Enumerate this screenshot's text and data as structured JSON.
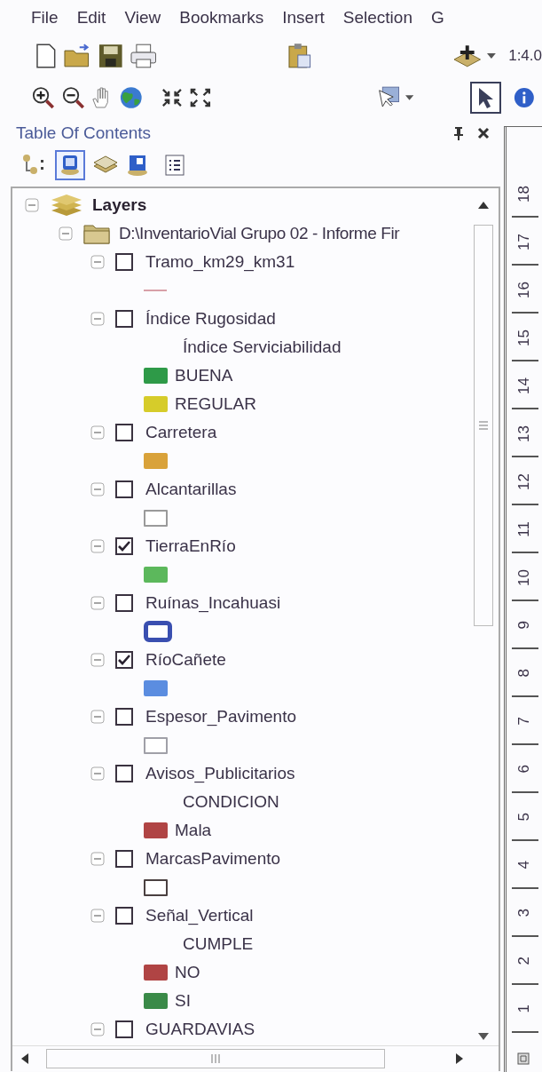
{
  "menu": [
    "File",
    "Edit",
    "View",
    "Bookmarks",
    "Insert",
    "Selection",
    "G"
  ],
  "toolbar": {
    "scale": "1:4.0"
  },
  "toc": {
    "title": "Table Of Contents",
    "tree": {
      "label": "Layers",
      "expanded": true,
      "children": [
        {
          "label": "D:\\InventarioVial Grupo 02 - Informe Fir",
          "expanded": true,
          "children": [
            {
              "name": "Tramo_km29_km31",
              "checked": false,
              "expanded": true,
              "legend": [
                {
                  "kind": "line",
                  "color": "#d8a0a8"
                }
              ]
            },
            {
              "name": "Índice Rugosidad",
              "checked": false,
              "expanded": true,
              "legend": [
                {
                  "kind": "heading",
                  "label": "Índice Serviciabilidad"
                },
                {
                  "kind": "fill",
                  "label": "BUENA",
                  "color": "#2e9a48"
                },
                {
                  "kind": "fill",
                  "label": "REGULAR",
                  "color": "#d6cc2a"
                }
              ]
            },
            {
              "name": "Carretera",
              "checked": false,
              "expanded": true,
              "legend": [
                {
                  "kind": "fill",
                  "color": "#d9a23a"
                }
              ]
            },
            {
              "name": "Alcantarillas",
              "checked": false,
              "expanded": true,
              "legend": [
                {
                  "kind": "outline",
                  "color": "#9a9a9a"
                }
              ]
            },
            {
              "name": "TierraEnRío",
              "checked": true,
              "expanded": true,
              "legend": [
                {
                  "kind": "fill",
                  "color": "#5cb85c"
                }
              ]
            },
            {
              "name": "Ruínas_Incahuasi",
              "checked": false,
              "expanded": true,
              "legend": [
                {
                  "kind": "thick-outline",
                  "color": "#3a4fb0"
                }
              ]
            },
            {
              "name": "RíoCañete",
              "checked": true,
              "expanded": true,
              "legend": [
                {
                  "kind": "fill",
                  "color": "#5b8de0"
                }
              ]
            },
            {
              "name": "Espesor_Pavimento",
              "checked": false,
              "expanded": true,
              "legend": [
                {
                  "kind": "outline",
                  "color": "#a0a0a8"
                }
              ]
            },
            {
              "name": "Avisos_Publicitarios",
              "checked": false,
              "expanded": true,
              "legend": [
                {
                  "kind": "heading",
                  "label": "CONDICION"
                },
                {
                  "kind": "fill",
                  "label": "Mala",
                  "color": "#b04444"
                }
              ]
            },
            {
              "name": "MarcasPavimento",
              "checked": false,
              "expanded": true,
              "legend": [
                {
                  "kind": "outline",
                  "color": "#4a4040"
                }
              ]
            },
            {
              "name": "Señal_Vertical",
              "checked": false,
              "expanded": true,
              "legend": [
                {
                  "kind": "heading",
                  "label": "CUMPLE"
                },
                {
                  "kind": "fill",
                  "label": "NO",
                  "color": "#b04444"
                },
                {
                  "kind": "fill",
                  "label": "SI",
                  "color": "#3a8a48"
                }
              ]
            },
            {
              "name": "GUARDAVIAS",
              "checked": false,
              "expanded": true
            }
          ]
        }
      ]
    }
  },
  "ruler": [
    "18",
    "17",
    "16",
    "15",
    "14",
    "13",
    "12",
    "11",
    "10",
    "9",
    "8",
    "7",
    "6",
    "5",
    "4",
    "3",
    "2",
    "1"
  ]
}
